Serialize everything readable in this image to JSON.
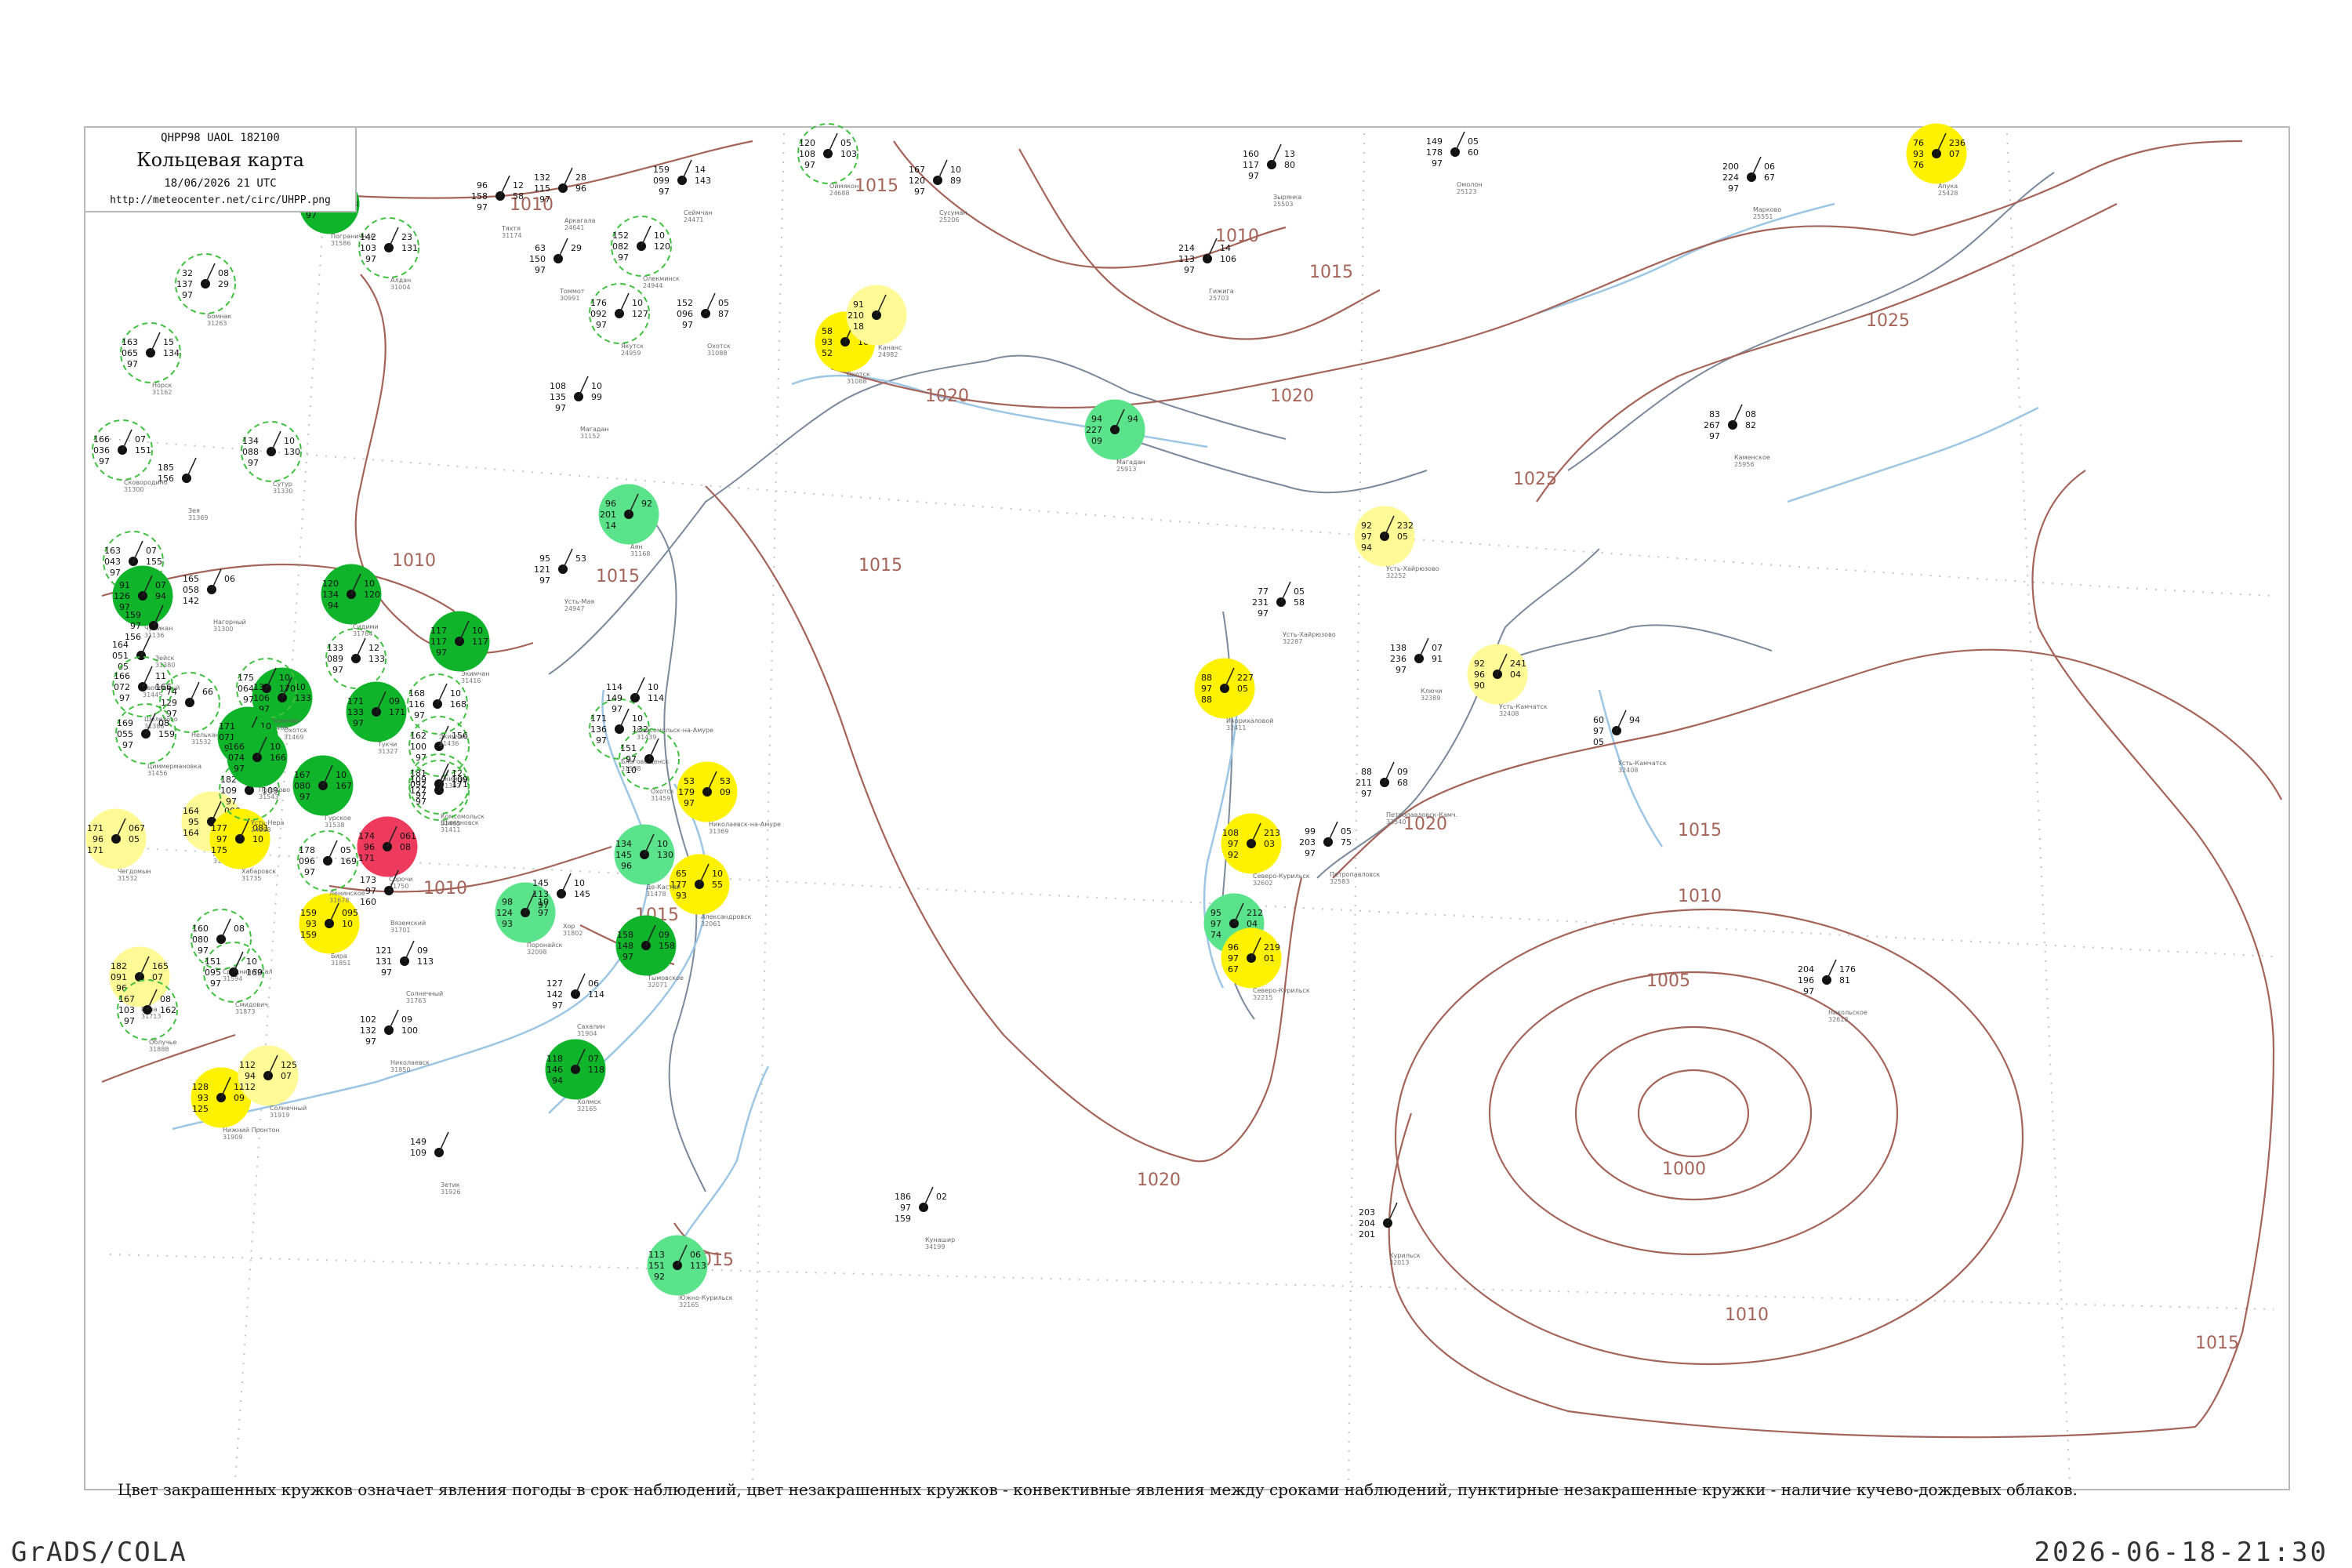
{
  "header": {
    "code_line": "QHPP98  UAOL  182100",
    "title": "Кольцевая карта",
    "date_line": "18/06/2026 21 UTC",
    "url": "http://meteocenter.net/circ/UHPP.png"
  },
  "caption": "Цвет закрашенных кружков означает явления погоды в срок наблюдений, цвет незакрашенных кружков - конвективные явления между сроками наблюдений, пунктирные незакрашенные кружки - наличие кучево-дождевых облаков.",
  "footer": {
    "left": "GrADS/COLA",
    "right": "2026-06-18-21:30"
  },
  "colors": {
    "isobar": "#a5645a",
    "river": "#9cc6e4",
    "coast": "#7a8a9a",
    "dark_green": "#0fb42a",
    "light_green": "#5be38b",
    "yellow": "#fff200",
    "pale_yellow": "#fffa96",
    "red": "#ee3a5c",
    "dashed_circle": "#40c040"
  },
  "isobar_labels": [
    "1010",
    "1010",
    "1010",
    "1010",
    "1015",
    "1015",
    "1015",
    "1015",
    "1015",
    "1020",
    "1020",
    "1020",
    "1020",
    "1025",
    "1025",
    "1015",
    "1010",
    "1005",
    "1000",
    "1010",
    "1015",
    "1015"
  ],
  "stations": [
    {
      "name": "Нижний Пронтон",
      "id": "31909",
      "values": [
        "128",
        "93",
        "125",
        "120",
        "09"
      ],
      "marker": "yellow"
    },
    {
      "name": "Солнечный",
      "id": "31919",
      "values": [
        "112",
        "94",
        "112",
        "125",
        "07"
      ],
      "marker": "pale_yellow"
    },
    {
      "name": "Чегдомын",
      "id": "31532",
      "values": [
        "171",
        "96",
        "171",
        "067",
        "05"
      ],
      "marker": "pale_yellow"
    },
    {
      "name": "Бира",
      "id": "31851",
      "values": [
        "159",
        "93",
        "159",
        "095",
        "10"
      ],
      "marker": "yellow"
    },
    {
      "name": "Амгунь",
      "id": "31753",
      "values": [
        "164",
        "95",
        "164",
        "000",
        "01"
      ],
      "marker": "pale_yellow"
    },
    {
      "name": "Хабаровск",
      "id": "31735",
      "values": [
        "177",
        "97",
        "175",
        "081",
        "10"
      ],
      "marker": "yellow"
    },
    {
      "name": "Сорочи",
      "id": "31750",
      "values": [
        "174",
        "96",
        "171",
        "061",
        "08"
      ],
      "marker": "red"
    },
    {
      "name": "Охотск",
      "id": "31088",
      "values": [
        "58",
        "93",
        "52",
        "216",
        "16"
      ],
      "marker": "yellow"
    },
    {
      "name": "Кананс",
      "id": "24982",
      "values": [
        "91",
        "210",
        "18"
      ],
      "marker": "pale_yellow"
    },
    {
      "name": "Апука",
      "id": "25428",
      "values": [
        "76",
        "93",
        "76",
        "236",
        "07"
      ],
      "marker": "yellow"
    },
    {
      "name": "Усть-Хайрюзово",
      "id": "32252",
      "values": [
        "92",
        "97",
        "94",
        "232",
        "05"
      ],
      "marker": "pale_yellow"
    },
    {
      "name": "Усть-Камчатск",
      "id": "32408",
      "values": [
        "92",
        "96",
        "90",
        "241",
        "04"
      ],
      "marker": "pale_yellow"
    },
    {
      "name": "Икорихаловой",
      "id": "32411",
      "values": [
        "88",
        "97",
        "88",
        "227",
        "05"
      ],
      "marker": "yellow"
    },
    {
      "name": "Северо-Курильск",
      "id": "32602",
      "values": [
        "108",
        "97",
        "92",
        "213",
        "03"
      ],
      "marker": "yellow"
    },
    {
      "name": "Мыс Лопатка",
      "id": "32618",
      "values": [
        "95",
        "97",
        "74",
        "212",
        "04"
      ],
      "marker": "light_green"
    },
    {
      "name": "Северо-Курильск",
      "id": "32215",
      "values": [
        "96",
        "97",
        "67",
        "219",
        "01"
      ],
      "marker": "yellow"
    },
    {
      "name": "Магадан",
      "id": "25913",
      "values": [
        "94",
        "227",
        "09",
        "94"
      ],
      "marker": "light_green"
    },
    {
      "name": "Аян",
      "id": "31168",
      "values": [
        "96",
        "201",
        "14",
        "92"
      ],
      "marker": "light_green"
    },
    {
      "name": "Николаевск-на-Амуре",
      "id": "31369",
      "values": [
        "53",
        "179",
        "97",
        "53",
        "09"
      ],
      "marker": "yellow"
    },
    {
      "name": "Александровск",
      "id": "32061",
      "values": [
        "65",
        "177",
        "93",
        "10",
        "55"
      ],
      "marker": "yellow"
    },
    {
      "name": "Де-Кастри",
      "id": "31478",
      "values": [
        "134",
        "145",
        "96",
        "10",
        "130"
      ],
      "marker": "light_green"
    },
    {
      "name": "Тымовское",
      "id": "32071",
      "values": [
        "158",
        "148",
        "97",
        "09",
        "158"
      ],
      "marker": "dark_green"
    },
    {
      "name": "Поронайск",
      "id": "32098",
      "values": [
        "98",
        "124",
        "93",
        "10",
        "97"
      ],
      "marker": "light_green"
    },
    {
      "name": "Холмск",
      "id": "32165",
      "values": [
        "118",
        "146",
        "94",
        "07",
        "118"
      ],
      "marker": "dark_green"
    },
    {
      "name": "Южно-Курильск",
      "id": "32165",
      "values": [
        "113",
        "151",
        "92",
        "06",
        "113"
      ],
      "marker": "light_green"
    },
    {
      "name": "Оймякон",
      "id": "24688",
      "values": [
        "120",
        "108",
        "97",
        "05",
        "103"
      ],
      "marker": "dashed"
    },
    {
      "name": "Сусуман",
      "id": "25206",
      "values": [
        "167",
        "120",
        "97",
        "10",
        "89"
      ],
      "marker": "none"
    },
    {
      "name": "Зырянка",
      "id": "25503",
      "values": [
        "160",
        "117",
        "97",
        "13",
        "80"
      ],
      "marker": "none"
    },
    {
      "name": "Омолон",
      "id": "25123",
      "values": [
        "149",
        "178",
        "97",
        "05",
        "60"
      ],
      "marker": "none"
    },
    {
      "name": "Марково",
      "id": "25551",
      "values": [
        "200",
        "224",
        "97",
        "06",
        "67"
      ],
      "marker": "none"
    },
    {
      "name": "Гижига",
      "id": "25703",
      "values": [
        "214",
        "113",
        "97",
        "14",
        "106"
      ],
      "marker": "none"
    },
    {
      "name": "Каменское",
      "id": "25956",
      "values": [
        "83",
        "267",
        "97",
        "08",
        "82"
      ],
      "marker": "none"
    },
    {
      "name": "Усть-Хайрюзово",
      "id": "32287",
      "values": [
        "77",
        "231",
        "97",
        "05",
        "58"
      ],
      "marker": "none"
    },
    {
      "name": "Ключи",
      "id": "32389",
      "values": [
        "138",
        "236",
        "97",
        "07",
        "91"
      ],
      "marker": "none"
    },
    {
      "name": "Усть-Камчатск",
      "id": "32408",
      "values": [
        "60",
        "97",
        "05",
        "94"
      ],
      "marker": "none"
    },
    {
      "name": "Петропавловск-Камч.",
      "id": "32540",
      "values": [
        "88",
        "211",
        "97",
        "09",
        "68"
      ],
      "marker": "none"
    },
    {
      "name": "Петропавловск",
      "id": "32583",
      "values": [
        "99",
        "203",
        "97",
        "05",
        "75"
      ],
      "marker": "none"
    },
    {
      "name": "Никольское",
      "id": "32618",
      "values": [
        "204",
        "196",
        "97",
        "176",
        "81"
      ],
      "marker": "none"
    },
    {
      "name": "Курильск",
      "id": "32013",
      "values": [
        "203",
        "204",
        "201"
      ],
      "marker": "none"
    },
    {
      "name": "Кунашир",
      "id": "34199",
      "values": [
        "186",
        "97",
        "159",
        "02"
      ],
      "marker": "none"
    },
    {
      "name": "Сахалин",
      "id": "31904",
      "values": [
        "127",
        "142",
        "97",
        "06",
        "114"
      ],
      "marker": "none"
    },
    {
      "name": "Николаевск",
      "id": "31850",
      "values": [
        "102",
        "132",
        "97",
        "09",
        "100"
      ],
      "marker": "none"
    },
    {
      "name": "Зетик",
      "id": "31926",
      "values": [
        "149",
        "109"
      ],
      "marker": "none"
    },
    {
      "name": "Охотск",
      "id": "31088",
      "values": [
        "152",
        "096",
        "97",
        "05",
        "87"
      ],
      "marker": "none"
    },
    {
      "name": "Сеймчан",
      "id": "24471",
      "values": [
        "159",
        "099",
        "97",
        "14",
        "143"
      ],
      "marker": "none"
    },
    {
      "name": "Аркагала",
      "id": "24641",
      "values": [
        "132",
        "115",
        "97",
        "28",
        "96"
      ],
      "marker": "none"
    },
    {
      "name": "Магадан",
      "id": "31152",
      "values": [
        "108",
        "135",
        "97",
        "10",
        "99"
      ],
      "marker": "none"
    },
    {
      "name": "Усть-Мая",
      "id": "24947",
      "values": [
        "95",
        "121",
        "97",
        "53"
      ],
      "marker": "none"
    },
    {
      "name": "Тяхтя",
      "id": "31174",
      "values": [
        "96",
        "158",
        "97",
        "12",
        "58"
      ],
      "marker": "none"
    },
    {
      "name": "Нагорный",
      "id": "31300",
      "values": [
        "165",
        "058",
        "142",
        "06"
      ],
      "marker": "none"
    },
    {
      "name": "Благовещенск",
      "id": "31588",
      "values": [
        "171",
        "136",
        "97",
        "10",
        "132"
      ],
      "marker": "dashed"
    },
    {
      "name": "Комсомольск-на-Амуре",
      "id": "31439",
      "values": [
        "114",
        "149",
        "97",
        "10",
        "114"
      ],
      "marker": "none"
    },
    {
      "name": "Охотск",
      "id": "31459",
      "values": [
        "151",
        "97",
        "10"
      ],
      "marker": "dashed"
    },
    {
      "name": "Экимчан",
      "id": "31392",
      "values": [
        "162",
        "100",
        "97",
        "156"
      ],
      "marker": "dashed"
    },
    {
      "name": "Комсомольск",
      "id": "31465",
      "values": [
        "181",
        "092",
        "97",
        "12",
        "171"
      ],
      "marker": "dashed"
    },
    {
      "name": "Свободный",
      "id": "31445",
      "values": [
        "164",
        "051",
        "05"
      ],
      "marker": "none"
    },
    {
      "name": "Тында",
      "id": "31300",
      "values": [
        "163",
        "043",
        "97",
        "07",
        "155"
      ],
      "marker": "dashed"
    },
    {
      "name": "Сковородино",
      "id": "31300",
      "values": [
        "166",
        "036",
        "97",
        "07",
        "151"
      ],
      "marker": "dashed"
    },
    {
      "name": "Зея",
      "id": "31369",
      "values": [
        "185",
        "156"
      ],
      "marker": "none"
    },
    {
      "name": "Сутур",
      "id": "31330",
      "values": [
        "134",
        "088",
        "97",
        "10",
        "130"
      ],
      "marker": "dashed"
    },
    {
      "name": "Норск",
      "id": "31162",
      "values": [
        "163",
        "065",
        "97",
        "15",
        "134"
      ],
      "marker": "dashed"
    },
    {
      "name": "Бомнак",
      "id": "31263",
      "values": [
        "32",
        "137",
        "97",
        "08",
        "29"
      ],
      "marker": "dashed"
    },
    {
      "name": "Алдан",
      "id": "31004",
      "values": [
        "142",
        "103",
        "97",
        "23",
        "131"
      ],
      "marker": "dashed"
    },
    {
      "name": "Томмот",
      "id": "30991",
      "values": [
        "63",
        "150",
        "97",
        "29"
      ],
      "marker": "none"
    },
    {
      "name": "Олекминск",
      "id": "24944",
      "values": [
        "152",
        "082",
        "97",
        "10",
        "120"
      ],
      "marker": "dashed"
    },
    {
      "name": "Якутск",
      "id": "24959",
      "values": [
        "176",
        "092",
        "97",
        "10",
        "127"
      ],
      "marker": "dashed"
    },
    {
      "name": "Усть-Нера",
      "id": "24688",
      "values": [
        "182",
        "109",
        "97",
        "12",
        "109"
      ],
      "marker": "dashed"
    },
    {
      "name": "Средний Ургал",
      "id": "31594",
      "values": [
        "160",
        "080",
        "97",
        "08"
      ],
      "marker": "dashed"
    },
    {
      "name": "Бира",
      "id": "31713",
      "values": [
        "182",
        "091",
        "96",
        "165",
        "07"
      ],
      "marker": "pale_yellow"
    },
    {
      "name": "Смидович",
      "id": "31873",
      "values": [
        "151",
        "095",
        "97",
        "10",
        "169"
      ],
      "marker": "dashed"
    },
    {
      "name": "Облучье",
      "id": "31888",
      "values": [
        "167",
        "103",
        "97",
        "08",
        "162"
      ],
      "marker": "dashed"
    },
    {
      "name": "Ленинское",
      "id": "31678",
      "values": [
        "178",
        "096",
        "97",
        "05",
        "169"
      ],
      "marker": "dashed"
    },
    {
      "name": "Вяземский",
      "id": "31701",
      "values": [
        "173",
        "97",
        "160"
      ],
      "marker": "none"
    },
    {
      "name": "Хор",
      "id": "31802",
      "values": [
        "145",
        "113",
        "97",
        "10",
        "145"
      ],
      "marker": "none"
    },
    {
      "name": "Солнечный",
      "id": "31763",
      "values": [
        "121",
        "131",
        "97",
        "09",
        "113"
      ],
      "marker": "none"
    },
    {
      "name": "Сидими",
      "id": "31784",
      "values": [
        "120",
        "134",
        "94",
        "10",
        "120"
      ],
      "marker": "dark_green"
    },
    {
      "name": "Бомнак",
      "id": "31375",
      "values": [
        "133",
        "089",
        "97",
        "12",
        "133"
      ],
      "marker": "dashed"
    },
    {
      "name": "Экимчан",
      "id": "31416",
      "values": [
        "117",
        "117",
        "97",
        "10",
        "117"
      ],
      "marker": "dark_green"
    },
    {
      "name": "Тукчи",
      "id": "31327",
      "values": [
        "171",
        "133",
        "97",
        "09",
        "171"
      ],
      "marker": "dark_green"
    },
    {
      "name": "Охотск",
      "id": "31469",
      "values": [
        "133",
        "106",
        "97",
        "10",
        "133"
      ],
      "marker": "dark_green"
    },
    {
      "name": "Экимчан",
      "id": "31436",
      "values": [
        "168",
        "116",
        "97",
        "10",
        "168"
      ],
      "marker": "dashed"
    },
    {
      "name": "Шимановск",
      "id": "31411",
      "values": [
        "109",
        "127",
        "97",
        "109"
      ],
      "marker": "dashed"
    },
    {
      "name": "Нелькан",
      "id": "31532",
      "values": [
        "74",
        "129",
        "97",
        "66"
      ],
      "marker": "dashed"
    },
    {
      "name": "Шелехово",
      "id": "31388",
      "values": [
        "166",
        "072",
        "97",
        "11",
        "166"
      ],
      "marker": "dashed"
    },
    {
      "name": "Циммермановка",
      "id": "31456",
      "values": [
        "169",
        "055",
        "97",
        "08",
        "159"
      ],
      "marker": "dashed"
    },
    {
      "name": "Мазаново",
      "id": "31489",
      "values": [
        "175",
        "064",
        "97",
        "10",
        "170"
      ],
      "marker": "dashed"
    },
    {
      "name": "Архара",
      "id": "31520",
      "values": [
        "171",
        "071",
        "97",
        "10",
        "171"
      ],
      "marker": "dark_green"
    },
    {
      "name": "Поярково",
      "id": "31543",
      "values": [
        "166",
        "074",
        "97",
        "10",
        "166"
      ],
      "marker": "dark_green"
    },
    {
      "name": "Гурское",
      "id": "31538",
      "values": [
        "167",
        "080",
        "97",
        "10",
        "167"
      ],
      "marker": "dark_green"
    },
    {
      "name": "Пограничное",
      "id": "31586",
      "values": [
        "133",
        "088",
        "97",
        "10",
        "133"
      ],
      "marker": "dark_green"
    },
    {
      "name": "Чумикан",
      "id": "31136",
      "values": [
        "91",
        "126",
        "97",
        "07",
        "94"
      ],
      "marker": "dark_green"
    },
    {
      "name": "Зейск",
      "id": "31380",
      "values": [
        "159",
        "97",
        "156"
      ],
      "marker": "none"
    },
    {
      "name": "Завитинск",
      "id": "31490",
      "values": [
        "164",
        "159",
        "156"
      ],
      "marker": "none"
    }
  ]
}
